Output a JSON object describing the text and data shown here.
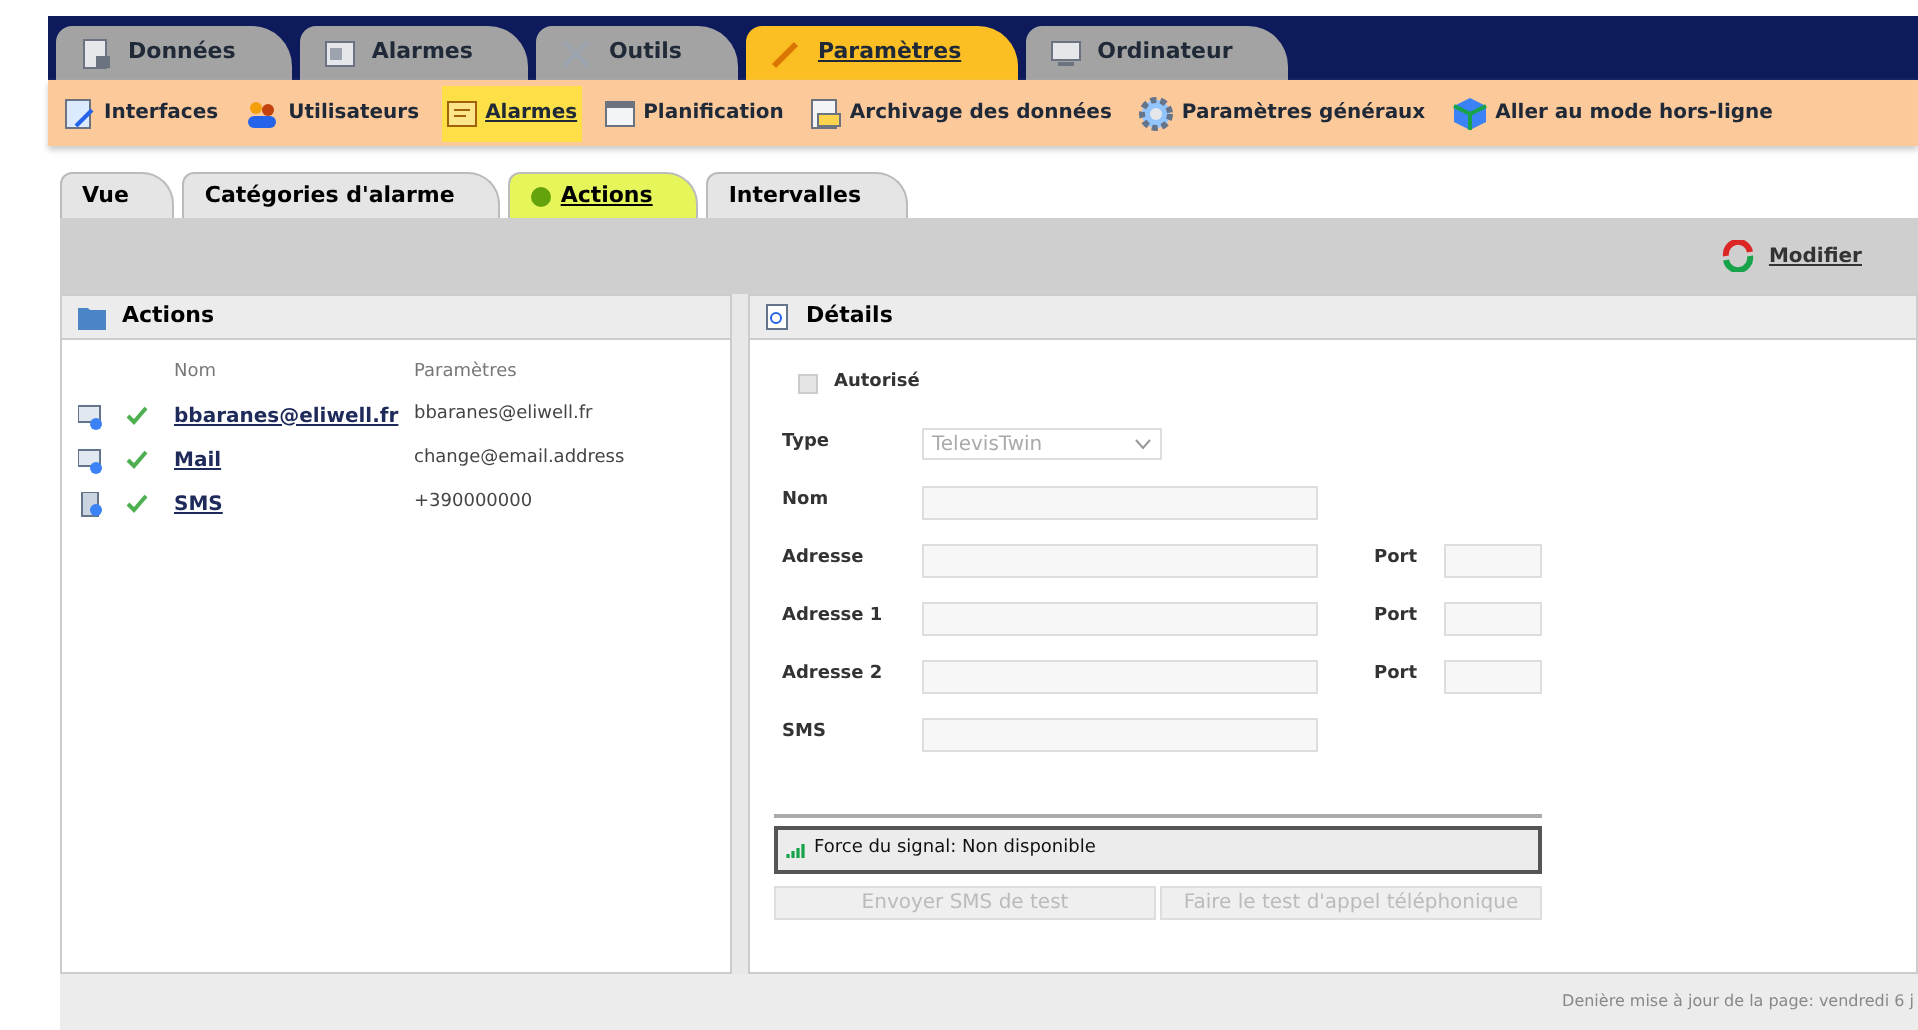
{
  "main_tabs": [
    {
      "label": "Données",
      "kind": "data",
      "selected": false
    },
    {
      "label": "Alarmes",
      "kind": "alarm",
      "selected": false
    },
    {
      "label": "Outils",
      "kind": "tools",
      "selected": false
    },
    {
      "label": "Paramètres",
      "kind": "pencil",
      "selected": true
    },
    {
      "label": "Ordinateur",
      "kind": "computer",
      "selected": false
    }
  ],
  "toolbar": [
    {
      "label": "Interfaces",
      "kind": "interfaces",
      "selected": false
    },
    {
      "label": "Utilisateurs",
      "kind": "users",
      "selected": false
    },
    {
      "label": "Alarmes",
      "kind": "alarm",
      "selected": true
    },
    {
      "label": "Planification",
      "kind": "calendar",
      "selected": false
    },
    {
      "label": "Archivage des données",
      "kind": "archive",
      "selected": false
    },
    {
      "label": "Paramètres généraux",
      "kind": "gear",
      "selected": false
    },
    {
      "label": "Aller au mode hors-ligne",
      "kind": "offline",
      "selected": false
    }
  ],
  "sub_tabs": [
    {
      "label": "Vue",
      "selected": false
    },
    {
      "label": "Catégories d'alarme",
      "selected": false
    },
    {
      "label": "Actions",
      "selected": true
    },
    {
      "label": "Intervalles",
      "selected": false
    }
  ],
  "modifier_button": "Modifier",
  "actions_panel": {
    "title": "Actions",
    "columns": [
      "Nom",
      "Paramètres"
    ],
    "rows": [
      {
        "name": "bbaranes@eliwell.fr",
        "parameters": "bbaranes@eliwell.fr",
        "kind": "mail",
        "enabled": true
      },
      {
        "name": "Mail",
        "parameters": "change@email.address",
        "kind": "mail",
        "enabled": true
      },
      {
        "name": "SMS",
        "parameters": "+390000000",
        "kind": "sms",
        "enabled": true
      }
    ]
  },
  "details_panel": {
    "title": "Détails",
    "authorized": {
      "label": "Autorisé",
      "checked": false,
      "disabled": true
    },
    "type": {
      "label": "Type",
      "value": "TelevisTwin"
    },
    "fields": [
      {
        "label": "Nom"
      },
      {
        "label": "Adresse",
        "port_label": "Port"
      },
      {
        "label": "Adresse 1",
        "port_label": "Port"
      },
      {
        "label": "Adresse 2",
        "port_label": "Port"
      },
      {
        "label": "SMS"
      }
    ],
    "signal": "Force du signal: Non disponible",
    "buttons": [
      {
        "label": "Envoyer SMS de test",
        "disabled": true
      },
      {
        "label": "Faire le test d'appel téléphonique",
        "disabled": true
      }
    ]
  },
  "status_bar": "Denière mise à jour de la page: vendredi 6 j"
}
